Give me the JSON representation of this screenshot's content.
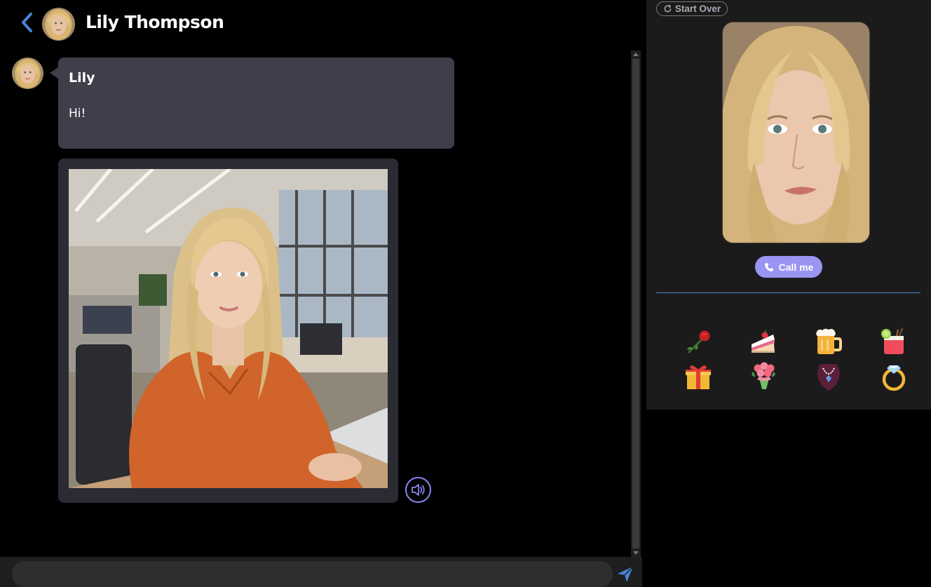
{
  "chat": {
    "contact_name": "Lily Thompson",
    "back_icon": "chevron-left-icon",
    "messages": [
      {
        "type": "text",
        "sender": "Lily",
        "text": "Hi!"
      },
      {
        "type": "image",
        "description_icon": "photo",
        "audio_icon": "speaker-icon"
      }
    ],
    "input": {
      "value": "",
      "placeholder": ""
    },
    "send_icon": "send-icon"
  },
  "profile": {
    "start_over_label": "Start Over",
    "call_label": "Call me",
    "gifts": [
      {
        "name": "rose"
      },
      {
        "name": "cake"
      },
      {
        "name": "beer"
      },
      {
        "name": "cocktail"
      },
      {
        "name": "gift-box"
      },
      {
        "name": "bouquet"
      },
      {
        "name": "necklace"
      },
      {
        "name": "ring"
      }
    ]
  },
  "colors": {
    "accent": "#9a94f2",
    "bubble": "#3e3f4b",
    "panel": "#1b1b1b",
    "divider": "#4d8ac2",
    "back_chevron": "#4a83d6"
  }
}
